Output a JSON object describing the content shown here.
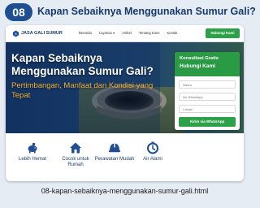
{
  "header": {
    "number": "08",
    "title": "Kapan Sebaiknya Menggunakan Sumur Gali?"
  },
  "site": {
    "logo_text": "JASA GALI SUMUR",
    "nav": {
      "links": [
        "Beranda",
        "Layanan ▾",
        "Artikel",
        "Tentang Kami",
        "Kontak"
      ],
      "cta": "Hubungi Kami"
    },
    "hero": {
      "title": "Kapan Sebaiknya Menggunakan Sumur Gali?",
      "subtitle": "Pertimbangan, Manfaat dan Kondisi yang Tepat"
    },
    "form": {
      "heading_1": "Konsultasi Gratis",
      "heading_2": "Hubungi Kami",
      "placeholders": [
        "Nama",
        "No WhatsApp",
        "Lokasi"
      ],
      "button": "Kirim via WhatsApp"
    },
    "features": [
      {
        "label": "Lebih Hemat",
        "icon": "piggy-bank-icon"
      },
      {
        "label": "Cocok untuk Rumah",
        "icon": "house-icon"
      },
      {
        "label": "Perawatan Mudah",
        "icon": "helmet-icon"
      },
      {
        "label": "Air Alami",
        "icon": "clock-icon"
      }
    ]
  },
  "caption": "08-kapan-sebaiknya-menggunakan-sumur-gali.html",
  "colors": {
    "navy": "#1f4f91",
    "green": "#2da14a",
    "accent": "#f2b234"
  }
}
